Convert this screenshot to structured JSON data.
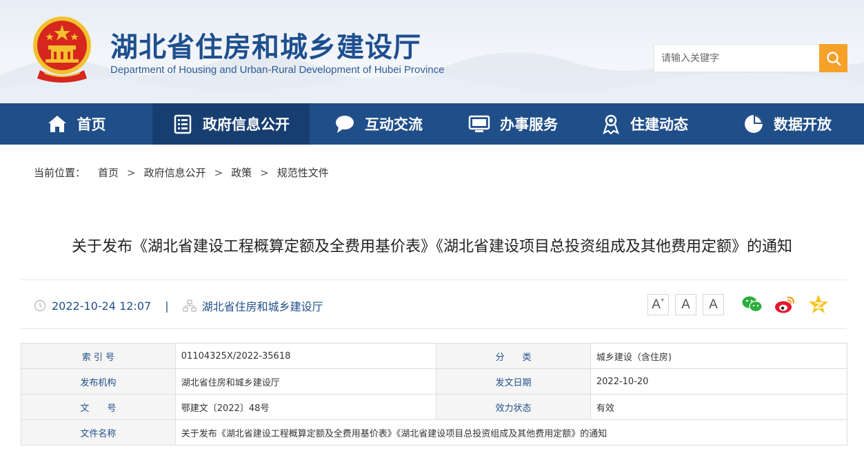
{
  "header": {
    "title": "湖北省住房和城乡建设厅",
    "subtitle": "Department of Housing and Urban-Rural Development of Hubei Province",
    "search_placeholder": "请输入关键字"
  },
  "nav": [
    {
      "label": "首页",
      "icon": "home-icon"
    },
    {
      "label": "政府信息公开",
      "icon": "document-list-icon",
      "active": true
    },
    {
      "label": "互动交流",
      "icon": "chat-bubble-icon"
    },
    {
      "label": "办事服务",
      "icon": "monitor-icon"
    },
    {
      "label": "住建动态",
      "icon": "award-person-icon"
    },
    {
      "label": "数据开放",
      "icon": "pie-chart-icon"
    }
  ],
  "breadcrumb": {
    "label": "当前位置：",
    "items": [
      "首页",
      "政府信息公开",
      "政策",
      "规范性文件"
    ],
    "separator": ">"
  },
  "article": {
    "title": "关于发布《湖北省建设工程概算定额及全费用基价表》《湖北省建设项目总投资组成及其他费用定额》的通知",
    "datetime": "2022-10-24 12:07",
    "separator": "|",
    "source": "湖北省住房和城乡建设厅"
  },
  "font_controls": {
    "increase": "A",
    "increase_sup": "+",
    "normal": "A",
    "decrease": "A"
  },
  "info_table": {
    "index_label": "索 引 号",
    "index_value": "01104325X/2022-35618",
    "category_label": "分　　类",
    "category_value": "城乡建设（含住房)",
    "publisher_label": "发布机构",
    "publisher_value": "湖北省住房和城乡建设厅",
    "date_label": "发文日期",
    "date_value": "2022-10-20",
    "docno_label": "文　　号",
    "docno_value": "鄂建文〔2022〕48号",
    "status_label": "效力状态",
    "status_value": "有效",
    "filename_label": "文件名称",
    "filename_value": "关于发布《湖北省建设工程概算定额及全费用基价表》《湖北省建设项目总投资组成及其他费用定额》的通知"
  },
  "colors": {
    "brand_blue": "#1f4e89",
    "nav_active": "#173e70",
    "search_orange": "#f5a12a",
    "emblem_red": "#d7261e",
    "emblem_gold": "#f2c12e"
  }
}
